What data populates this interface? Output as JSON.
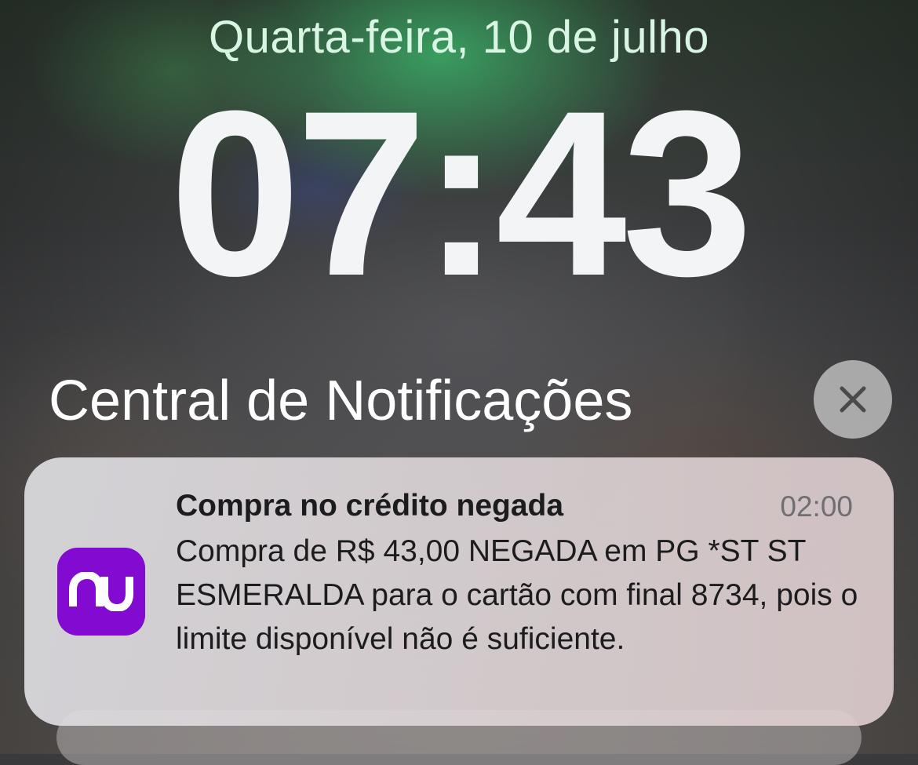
{
  "lock_screen": {
    "date": "Quarta-feira, 10 de julho",
    "time": "07:43"
  },
  "notification_center": {
    "title": "Central de Notificações",
    "close_icon": "close-icon"
  },
  "notification": {
    "app_icon": "nubank-logo",
    "app_icon_text": "nu",
    "app_icon_color": "#820ad1",
    "title": "Compra no crédito negada",
    "time": "02:00",
    "body": "Compra de R$ 43,00 NEGADA em PG *ST ST ESMERALDA para o cartão com final 8734, pois o limite disponível não é suficiente."
  }
}
